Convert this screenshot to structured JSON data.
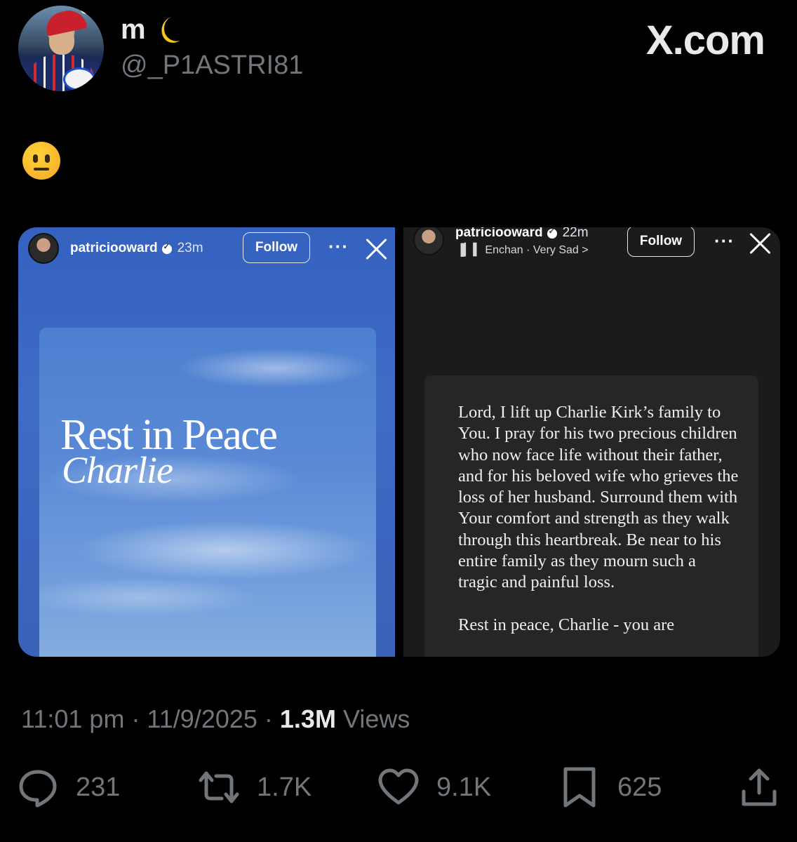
{
  "tweet": {
    "display_name": "m",
    "handle": "@_P1ASTRI81",
    "brand": "X.com",
    "timestamp": "11:01 pm · 11/9/2025 · ",
    "views_count": "1.3M",
    "views_label": " Views",
    "stats": {
      "replies": "231",
      "reposts": "1.7K",
      "likes": "9.1K",
      "bookmarks": "625"
    }
  },
  "story_left": {
    "username": "patriciooward",
    "time": "23m",
    "follow_label": "Follow",
    "more": "···",
    "title": "Rest in Peace",
    "name": "Charlie"
  },
  "story_right": {
    "username": "patriciooward",
    "time": "22m",
    "music": "Enchan · Very Sad >",
    "follow_label": "Follow",
    "more": "···",
    "prayer_p1": "Lord, I lift up Charlie Kirk’s family to You. I pray for his two precious children who now face life without their father, and for his beloved wife who grieves the loss of her husband. Surround them with Your comfort and strength as they walk through this heartbreak. Be near to his entire family as they mourn such a tragic and painful loss.",
    "prayer_p2": "Rest in peace, Charlie - you are"
  },
  "icons": {
    "reply": "speech-bubble-icon",
    "repost": "repost-arrows-icon",
    "like": "heart-icon",
    "bookmark": "bookmark-icon",
    "share": "share-upload-icon",
    "verified": "verified-badge-icon",
    "close": "close-icon",
    "music": "music-bars-icon"
  },
  "colors": {
    "background": "#000000",
    "secondary_text": "#71767b",
    "primary_text": "#e7e9ea",
    "story_blue": "#3a66c2"
  }
}
